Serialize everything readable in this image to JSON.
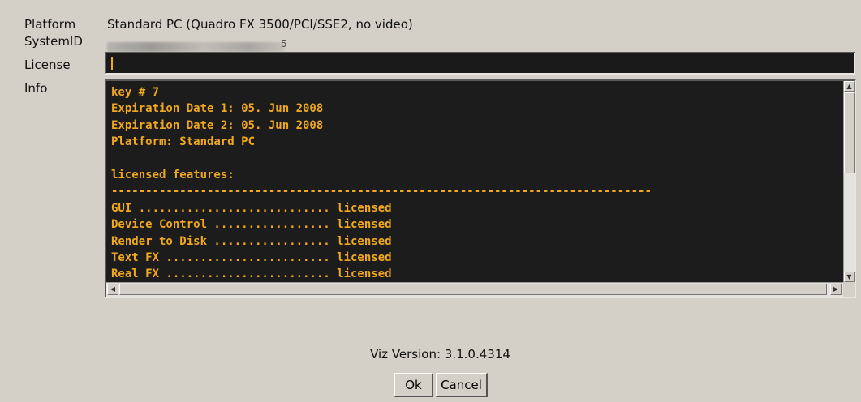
{
  "fields": {
    "platform_label": "Platform",
    "platform_value": "Standard PC (Quadro FX 3500/PCI/SSE2, no video)",
    "systemid_label": "SystemID",
    "systemid_visible_end": "5",
    "license_label": "License",
    "license_value": "",
    "info_label": "Info"
  },
  "info_lines": [
    "key # 7",
    "Expiration Date 1: 05. Jun 2008",
    "Expiration Date 2: 05. Jun 2008",
    "Platform: Standard PC",
    "",
    "licensed features:",
    "-------------------------------------------------------------------------------",
    "GUI ............................ licensed",
    "Device Control ................. licensed",
    "Render to Disk ................. licensed",
    "Text FX ........................ licensed",
    "Real FX ........................ licensed"
  ],
  "footer": {
    "version": "Viz Version: 3.1.0.4314"
  },
  "buttons": {
    "ok": "Ok",
    "cancel": "Cancel"
  },
  "icons": {
    "scroll_up": "scroll-up-arrow",
    "scroll_down": "scroll-down-arrow",
    "scroll_left": "scroll-left-arrow",
    "scroll_right": "scroll-right-arrow"
  },
  "colors": {
    "dialog_bg": "#d4d0c8",
    "console_bg": "#1c1c1c",
    "console_text": "#f0a81e"
  }
}
